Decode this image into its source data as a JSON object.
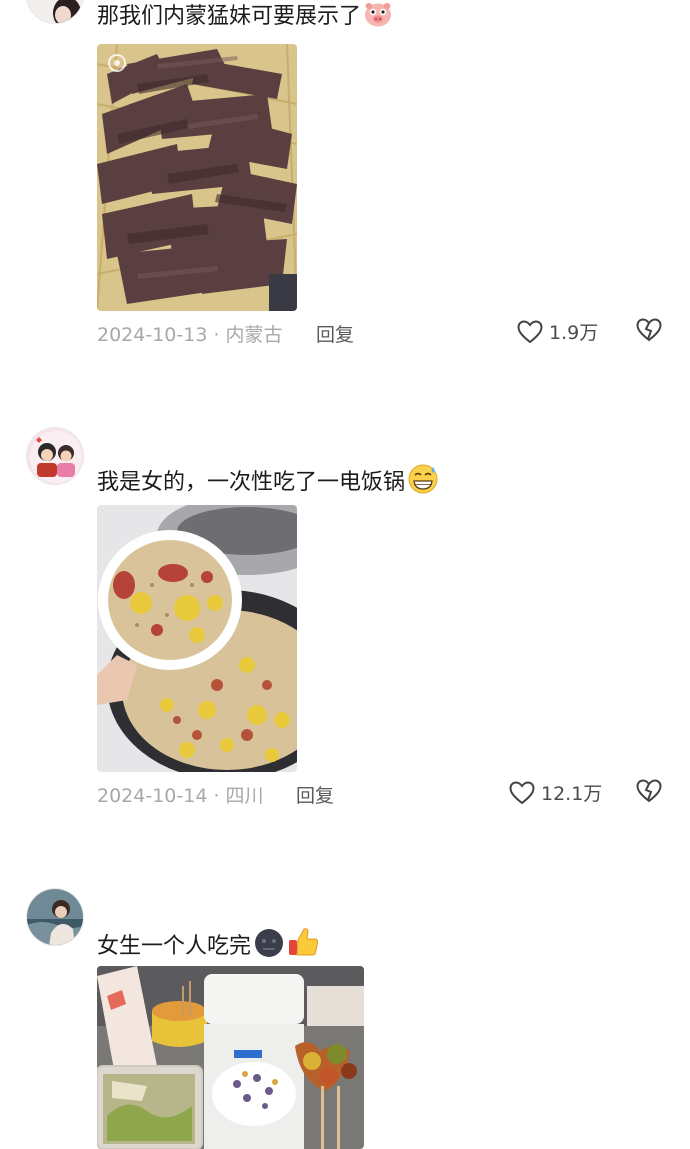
{
  "comments": [
    {
      "text": "那我们内蒙猛妹可要展示了",
      "emoji": "pig-face-emoji",
      "date": "2024-10-13",
      "location": "内蒙古",
      "reply_label": "回复",
      "likes": "1.9万",
      "photo_subject": "beef-jerky-in-basket"
    },
    {
      "text": "我是女的，一次性吃了一电饭锅",
      "emoji": "sweat-grin-emoji",
      "date": "2024-10-14",
      "location": "四川",
      "reply_label": "回复",
      "likes": "12.1万",
      "photo_subject": "rice-cooker-claypot-rice"
    },
    {
      "text": "女生一个人吃完",
      "emoji": "dark-face-emoji, thumbs-up-emoji",
      "photo_subject": "takeout-food-spread"
    }
  ],
  "colors": {
    "meta_gray": "#a8a8a8",
    "reply_gray": "#5a5a5a",
    "text_dark": "#1c1c1c"
  },
  "icons": [
    "heart-outline-icon",
    "broken-heart-icon"
  ]
}
